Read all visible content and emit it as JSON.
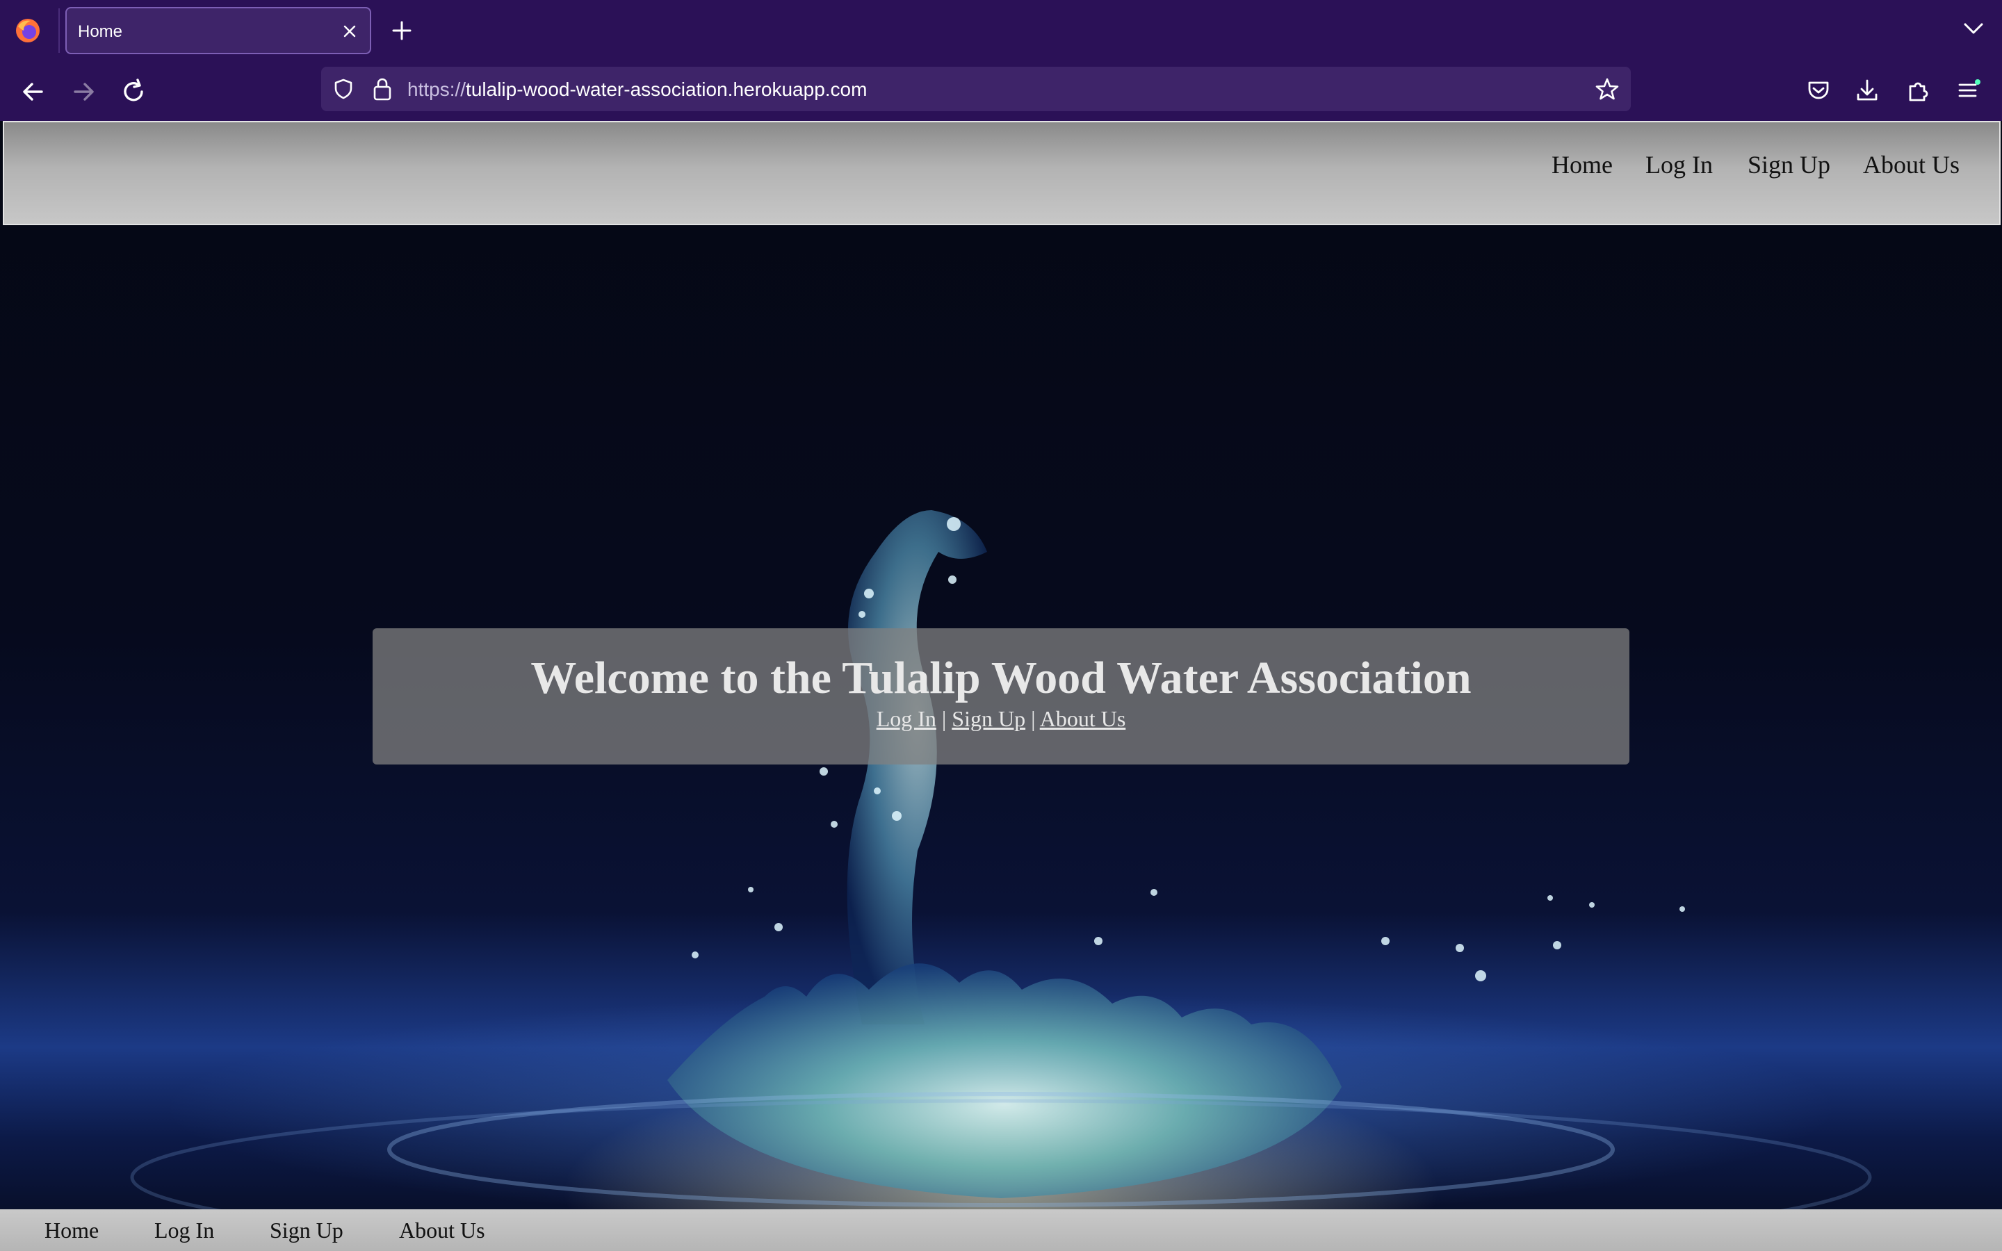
{
  "browser": {
    "tab_title": "Home",
    "url_scheme": "https://",
    "url_host": "tulalip-wood-water-association.herokuapp.com",
    "icons": [
      "firefox-logo",
      "close-icon",
      "plus-icon",
      "chevron-down-icon",
      "back-arrow-icon",
      "forward-arrow-icon",
      "reload-icon",
      "shield-icon",
      "lock-icon",
      "star-icon",
      "pocket-icon",
      "download-icon",
      "extensions-icon",
      "menu-icon"
    ]
  },
  "header_nav": {
    "home": "Home",
    "login": "Log In",
    "signup": "Sign Up",
    "about": "About Us"
  },
  "hero": {
    "title": "Welcome to the Tulalip Wood Water Association",
    "login": "Log In",
    "signup": "Sign Up",
    "about": "About Us",
    "separator": "|"
  },
  "footer_nav": {
    "home": "Home",
    "login": "Log In",
    "signup": "Sign Up",
    "about": "About Us"
  },
  "colors": {
    "browser_chrome": "#2b1157",
    "url_bar": "#3e2469",
    "welcome_box": "#808080"
  }
}
